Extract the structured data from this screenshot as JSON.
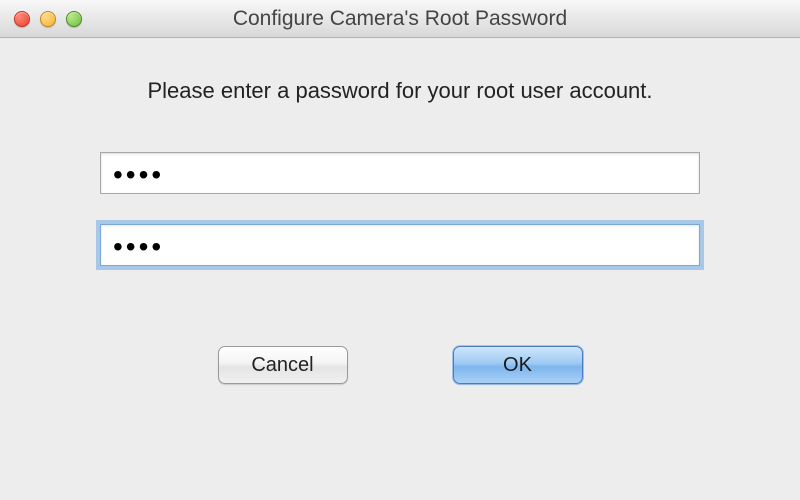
{
  "window": {
    "title": "Configure Camera's Root Password"
  },
  "dialog": {
    "instruction": "Please enter a password for your root user account.",
    "password_value": "••••",
    "confirm_value": "••••"
  },
  "buttons": {
    "cancel": "Cancel",
    "ok": "OK"
  }
}
